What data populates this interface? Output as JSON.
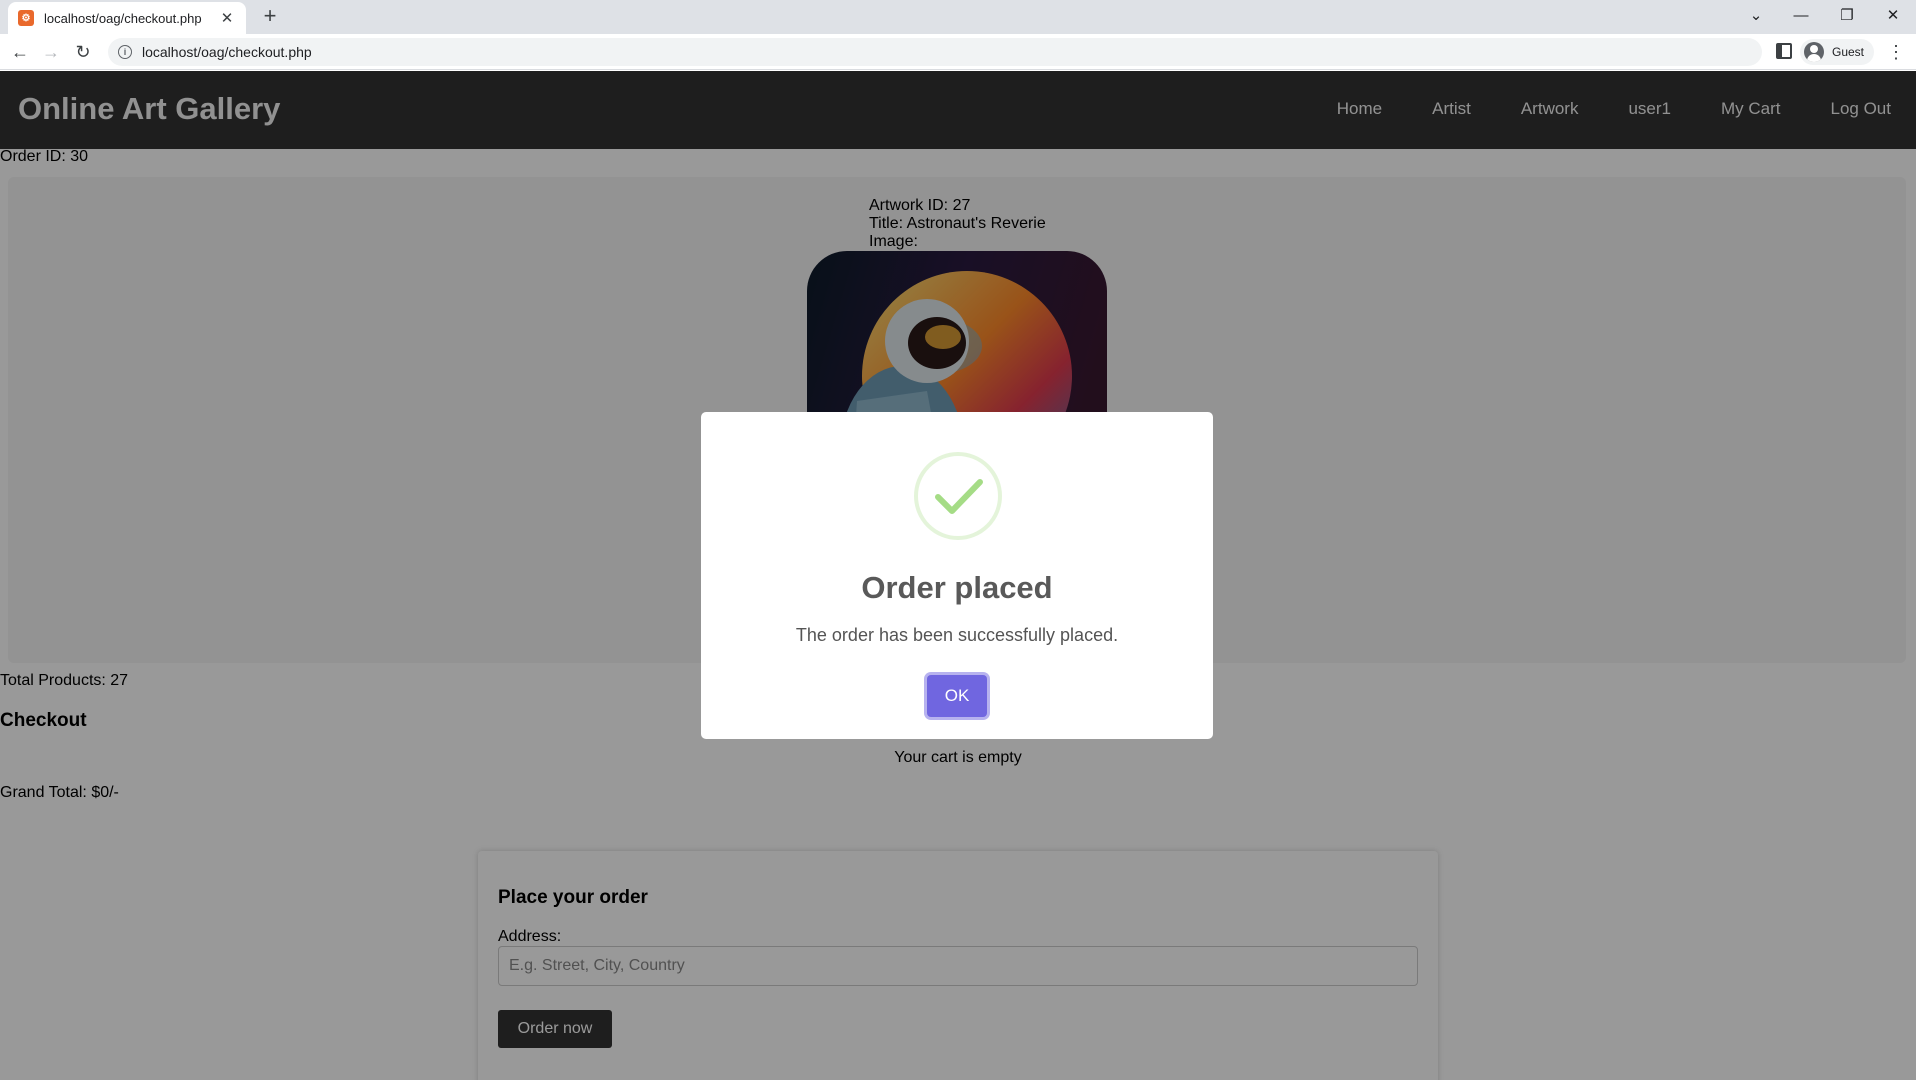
{
  "browser": {
    "tab_title": "localhost/oag/checkout.php",
    "favicon_text": "⚙",
    "tab_close": "✕",
    "new_tab": "+",
    "url": "localhost/oag/checkout.php",
    "profile_name": "Guest",
    "win_controls": {
      "tabsearch": "⌄",
      "minimize": "—",
      "restore": "❐",
      "close": "✕"
    },
    "nav": {
      "back": "←",
      "forward": "→",
      "reload": "↻",
      "menu": "⋮",
      "info": "i"
    }
  },
  "site": {
    "title": "Online Art Gallery",
    "nav": [
      "Home",
      "Artist",
      "Artwork",
      "user1",
      "My Cart",
      "Log Out"
    ]
  },
  "order": {
    "order_id_text": "Order ID: 30",
    "artwork_id_text": "Artwork ID: 27",
    "title_text": "Title: Astronaut's Reverie",
    "image_label": "Image:",
    "total_products_text": "Total Products: 27"
  },
  "checkout": {
    "heading": "Checkout",
    "cart_empty": "Your cart is empty",
    "grand_total": "Grand Total: $0/-",
    "form_title": "Place your order",
    "address_label": "Address:",
    "address_placeholder": "E.g. Street, City, Country",
    "address_value": "",
    "order_button": "Order now"
  },
  "modal": {
    "title": "Order placed",
    "text": "The order has been successfully placed.",
    "ok_button": "OK",
    "icon": "success-check-icon",
    "accent_color": "#7066e0",
    "success_color": "#a5dc86"
  }
}
